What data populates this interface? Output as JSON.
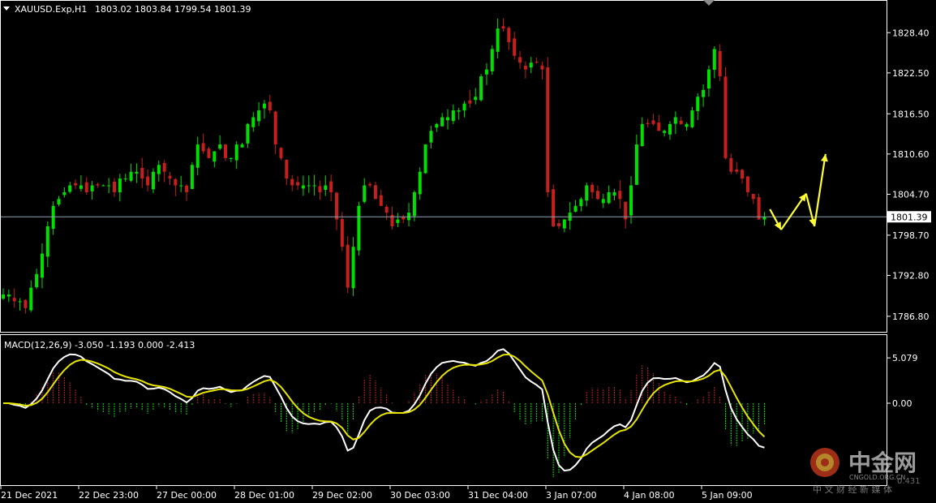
{
  "header": {
    "symbol": "XAUUSD.Exp,H1",
    "ohlc": "1803.02 1803.84 1799.54 1801.39"
  },
  "macd_header": {
    "label": "MACD(12,26,9) -3.050 -1.193 0.000 -2.413"
  },
  "watermark": {
    "title": "中金网",
    "url": "CNGOLD.ORG.CN",
    "subtitle": "中 文 财 经 新 媒 体",
    "stray_number": "0.431"
  },
  "colors": {
    "bull": "#00e000",
    "bear": "#c81e1e",
    "grid": "#ffffff",
    "price_line": "#8fa3b3",
    "macd_line": "#ffffff",
    "signal_line": "#e6e600",
    "forecast": "#ffff33"
  },
  "chart_data": [
    {
      "type": "candlestick",
      "title": "XAUUSD.Exp,H1",
      "current_price": "1801.39",
      "y_ticks": [
        "1828.40",
        "1822.50",
        "1816.50",
        "1810.60",
        "1804.70",
        "1798.70",
        "1792.80",
        "1786.80"
      ],
      "ylim": [
        1785.0,
        1832.0
      ],
      "x_ticks": [
        "21 Dec 2021",
        "22 Dec 23:00",
        "27 Dec 00:00",
        "28 Dec 01:00",
        "29 Dec 02:00",
        "30 Dec 03:00",
        "31 Dec 04:00",
        "3 Jan 07:00",
        "4 Jan 08:00",
        "5 Jan 09:00"
      ],
      "price_path": [
        1790,
        1790,
        1789,
        1789,
        1788,
        1791,
        1793,
        1796,
        1800,
        1803,
        1804,
        1805,
        1806,
        1806,
        1806,
        1805,
        1806,
        1806,
        1806,
        1806,
        1805,
        1807,
        1807,
        1808,
        1808,
        1807,
        1806,
        1808,
        1809,
        1808,
        1807,
        1806,
        1806,
        1805,
        1809,
        1812,
        1811,
        1810,
        1811,
        1812,
        1810,
        1810,
        1812,
        1812,
        1815,
        1816,
        1817,
        1818,
        1817,
        1812,
        1810,
        1807,
        1806,
        1806,
        1806,
        1806,
        1806,
        1805,
        1806,
        1805,
        1801,
        1797,
        1791,
        1797,
        1803,
        1806,
        1806,
        1804,
        1803,
        1802,
        1800,
        1801,
        1801,
        1802,
        1805,
        1808,
        1812,
        1814,
        1815,
        1816,
        1816,
        1817,
        1817,
        1818,
        1818,
        1819,
        1822,
        1823,
        1826,
        1829,
        1829,
        1827,
        1825,
        1824,
        1823,
        1824,
        1824,
        1823,
        1805,
        1800,
        1800,
        1801,
        1802,
        1803,
        1804,
        1806,
        1805,
        1804,
        1804,
        1805,
        1805,
        1804,
        1801,
        1806,
        1812,
        1815,
        1815,
        1815,
        1814,
        1814,
        1815,
        1816,
        1815,
        1815,
        1817,
        1819,
        1820,
        1823,
        1826,
        1822,
        1810,
        1808,
        1808,
        1807,
        1805,
        1804,
        1801,
        1801.39
      ],
      "forecast_arrows": [
        {
          "from": [
            138,
            1802.5
          ],
          "to": [
            140,
            1799.5
          ]
        },
        {
          "from": [
            140,
            1799.5
          ],
          "to": [
            144.5,
            1804.8
          ]
        },
        {
          "from": [
            144.5,
            1804.8
          ],
          "to": [
            146,
            1800.0
          ]
        },
        {
          "from": [
            146,
            1800.0
          ],
          "to": [
            148,
            1810.6
          ]
        }
      ]
    },
    {
      "type": "macd",
      "title": "MACD(12,26,9)",
      "values": {
        "macd": -3.05,
        "signal": -1.193,
        "osma": 0.0,
        "extra": -2.413
      },
      "y_ticks": [
        "5.079",
        "0.00"
      ],
      "ylim": [
        -9.0,
        7.0
      ]
    }
  ]
}
